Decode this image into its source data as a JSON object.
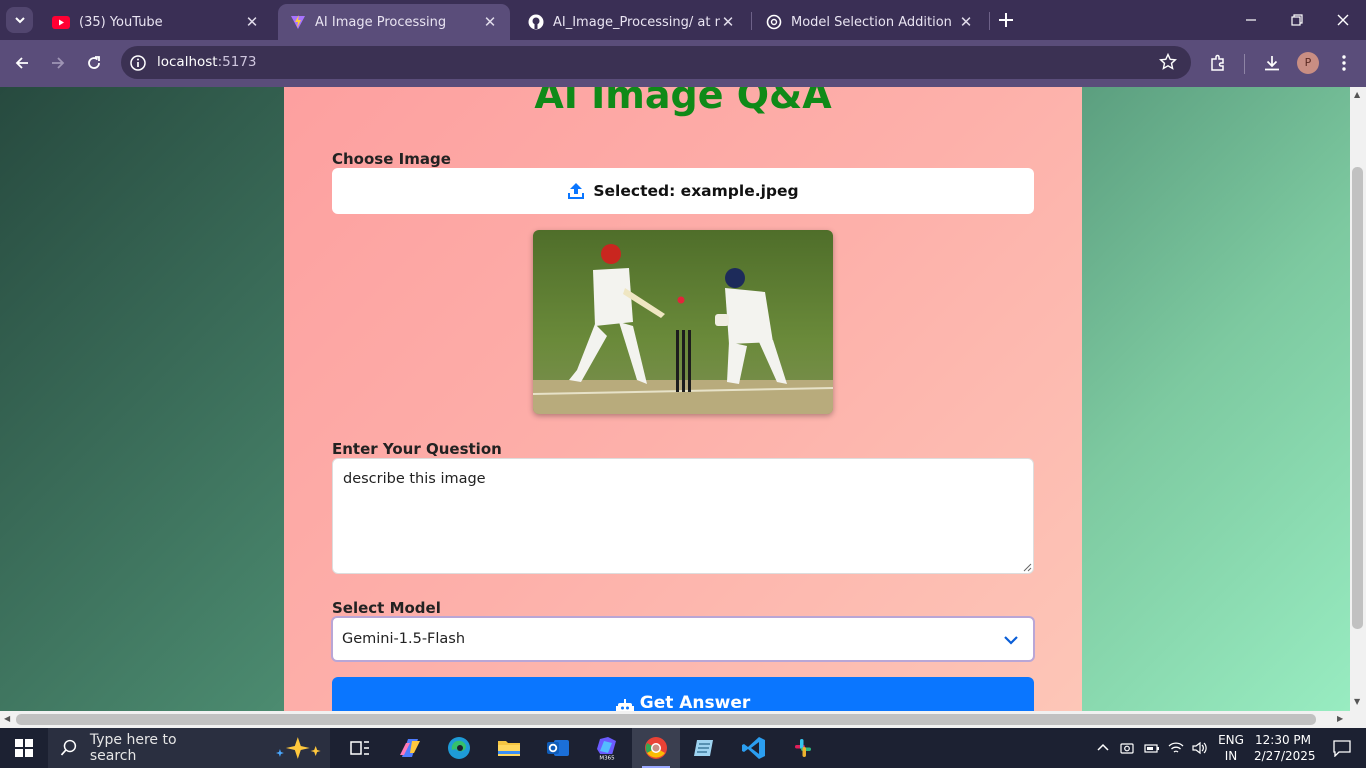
{
  "browser": {
    "tabs": [
      {
        "title": "(35) YouTube",
        "icon": "youtube-icon",
        "active": false
      },
      {
        "title": "AI Image Processing",
        "icon": "vite-icon",
        "active": true
      },
      {
        "title": "AI_Image_Processing/ at main ·",
        "icon": "github-icon",
        "active": false
      },
      {
        "title": "Model Selection Addition",
        "icon": "chatgpt-icon",
        "active": false
      }
    ],
    "url_host": "localhost",
    "url_port": ":5173",
    "profile_initial": "P"
  },
  "app": {
    "title": "AI Image Q&A",
    "choose_image_label": "Choose Image",
    "file_button_text": "Selected: example.jpeg",
    "question_label": "Enter Your Question",
    "question_value": "describe this image",
    "model_label": "Select Model",
    "model_selected": "Gemini-1.5-Flash",
    "submit_label": "Get Answer",
    "colors": {
      "title": "#0f8a18",
      "button": "#0a76ff"
    }
  },
  "taskbar": {
    "search_placeholder": "Type here to search",
    "lang_line1": "ENG",
    "lang_line2": "IN",
    "time": "12:30 PM",
    "date": "2/27/2025"
  }
}
